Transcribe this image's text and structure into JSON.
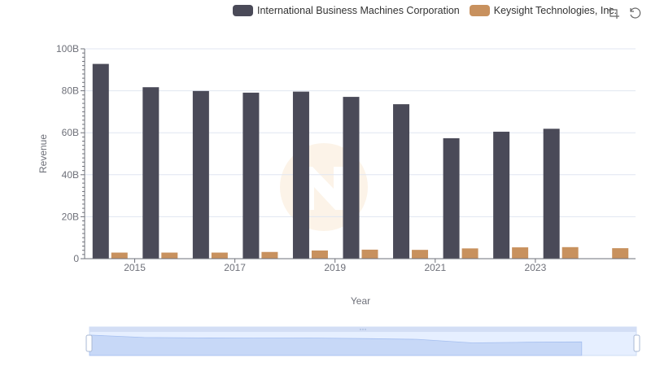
{
  "legend": {
    "items": [
      {
        "name": "International Business Machines Corporation",
        "color": "#4a4a58"
      },
      {
        "name": "Keysight Technologies, Inc.",
        "color": "#c8915e"
      }
    ]
  },
  "toolbox": {
    "zoom_icon": "zoom-icon",
    "restore_icon": "restore-icon"
  },
  "chart_data": {
    "type": "bar",
    "xlabel": "Year",
    "ylabel": "Revenue",
    "ylim": [
      0,
      100000000000
    ],
    "yticks": [
      "0",
      "20B",
      "40B",
      "60B",
      "80B",
      "100B"
    ],
    "x": [
      2014,
      2015,
      2016,
      2017,
      2018,
      2019,
      2020,
      2021,
      2022,
      2023,
      2024
    ],
    "xtick_labels": [
      "2015",
      "2017",
      "2019",
      "2021",
      "2023"
    ],
    "series": [
      {
        "name": "International Business Machines Corporation",
        "color": "#4a4a58",
        "values": [
          92800000000,
          81700000000,
          79900000000,
          79100000000,
          79600000000,
          77100000000,
          73600000000,
          57400000000,
          60500000000,
          61900000000,
          null
        ]
      },
      {
        "name": "Keysight Technologies, Inc.",
        "color": "#c8915e",
        "values": [
          2900000000,
          2900000000,
          2900000000,
          3200000000,
          3900000000,
          4300000000,
          4200000000,
          4900000000,
          5400000000,
          5500000000,
          5000000000
        ]
      }
    ],
    "grid": true,
    "legend_position": "top-right"
  }
}
